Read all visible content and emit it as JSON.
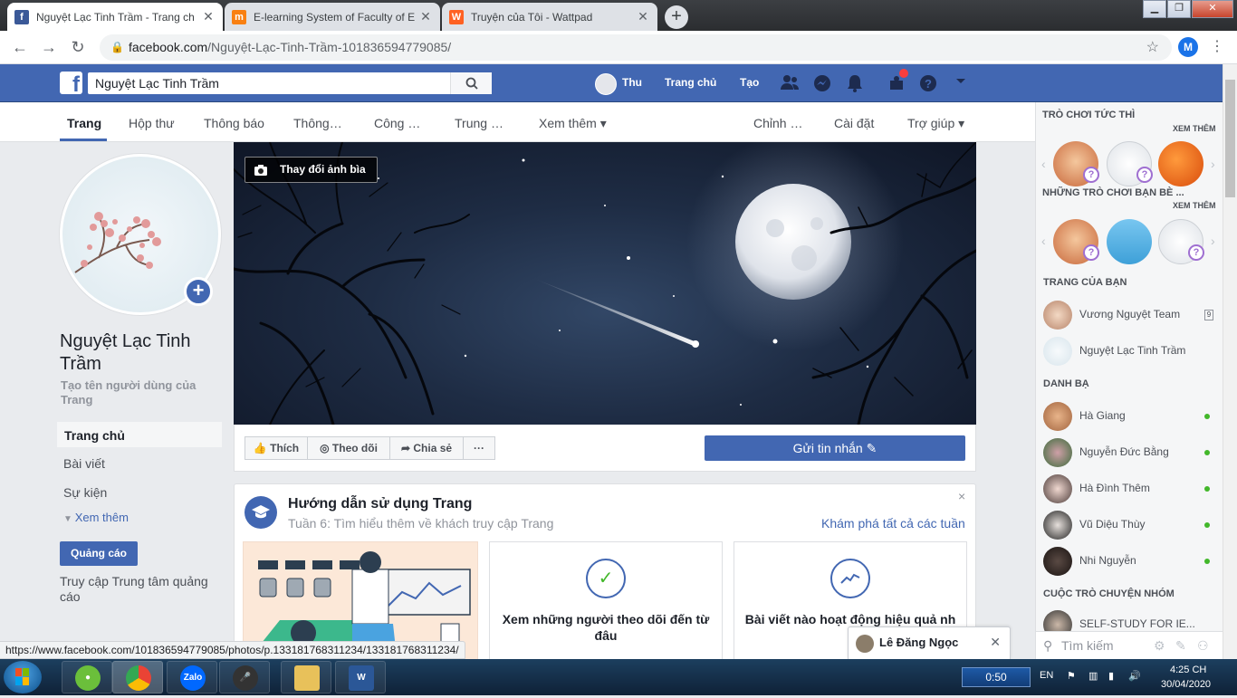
{
  "browser": {
    "tabs": [
      {
        "title": "Nguyệt Lạc Tinh Trầm - Trang ch",
        "favicon": "f",
        "favicon_color": "#3b5998"
      },
      {
        "title": "E-learning System of Faculty of E",
        "favicon": "m",
        "favicon_color": "#f98012"
      },
      {
        "title": "Truyện của Tôi - Wattpad",
        "favicon": "W",
        "favicon_color": "#ff6122"
      }
    ],
    "new_tab": "+",
    "url_host": "facebook.com",
    "url_path": "/Nguyệt-Lạc-Tinh-Trầm-101836594779085/",
    "profile_initial": "M",
    "status_url": "https://www.facebook.com/101836594779085/photos/p.133181768311234/133181768311234/"
  },
  "fb_header": {
    "search_value": "Nguyệt Lạc Tinh Trầm",
    "user_name": "Thu",
    "home": "Trang chủ",
    "create": "Tạo",
    "brand_color": "#4267b2"
  },
  "page_tabs": {
    "items": [
      "Trang",
      "Hộp thư",
      "Thông báo",
      "Thông…",
      "Công …",
      "Trung …",
      "Xem thêm ▾",
      "Chỉnh …",
      "Cài đặt",
      "Trợ giúp ▾"
    ]
  },
  "left": {
    "page_name": "Nguyệt Lạc Tinh Trầm",
    "username_prompt": "Tạo tên người dùng của Trang",
    "nav": [
      "Trang chủ",
      "Bài viết",
      "Sự kiện"
    ],
    "see_more": "Xem thêm",
    "ad_button": "Quảng cáo",
    "ad_center": "Truy cập Trung tâm quảng cáo"
  },
  "cover": {
    "change_cover": "Thay đổi ảnh bìa"
  },
  "actions": {
    "like": "Thích",
    "follow": "Theo dõi",
    "share": "Chia sẻ",
    "more": "···",
    "send_message": "Gửi tin nhắn"
  },
  "guide": {
    "title": "Hướng dẫn sử dụng Trang",
    "subtitle": "Tuần 6: Tìm hiểu thêm về khách truy cập Trang",
    "link": "Khám phá tất cả các tuần",
    "close": "×",
    "cards": [
      {
        "text": "Xem những người theo dõi đến từ đâu",
        "icon": "check-icon"
      },
      {
        "text": "Bài viết nào hoạt động hiệu quả nh",
        "icon": "chart-line-icon"
      }
    ]
  },
  "rightbar": {
    "instant_games": "TRÒ CHƠI TỨC THÌ",
    "see_more_1": "XEM THÊM",
    "friends_games": "NHỮNG TRÒ CHƠI BẠN BÈ ...",
    "see_more_2": "XEM THÊM",
    "your_pages": "TRANG CỦA BẠN",
    "pages": [
      "Vương Nguyệt Team",
      "Nguyệt Lạc Tinh Trầm"
    ],
    "contacts_head": "DANH BẠ",
    "contacts": [
      "Hà Giang",
      "Nguyễn Đức Bằng",
      "Hà Đình Thêm",
      "Vũ Diệu Thùy",
      "Nhi Nguyễn"
    ],
    "group_chats": "CUỘC TRÒ CHUYỆN NHÓM",
    "groups": [
      "SELF-STUDY FOR IE..."
    ],
    "search_placeholder": "Tìm kiếm"
  },
  "chat": {
    "name": "Lê Đăng Ngọc"
  },
  "taskbar": {
    "timer": "0:50",
    "lang": "EN",
    "time": "4:25 CH",
    "date": "30/04/2020"
  }
}
